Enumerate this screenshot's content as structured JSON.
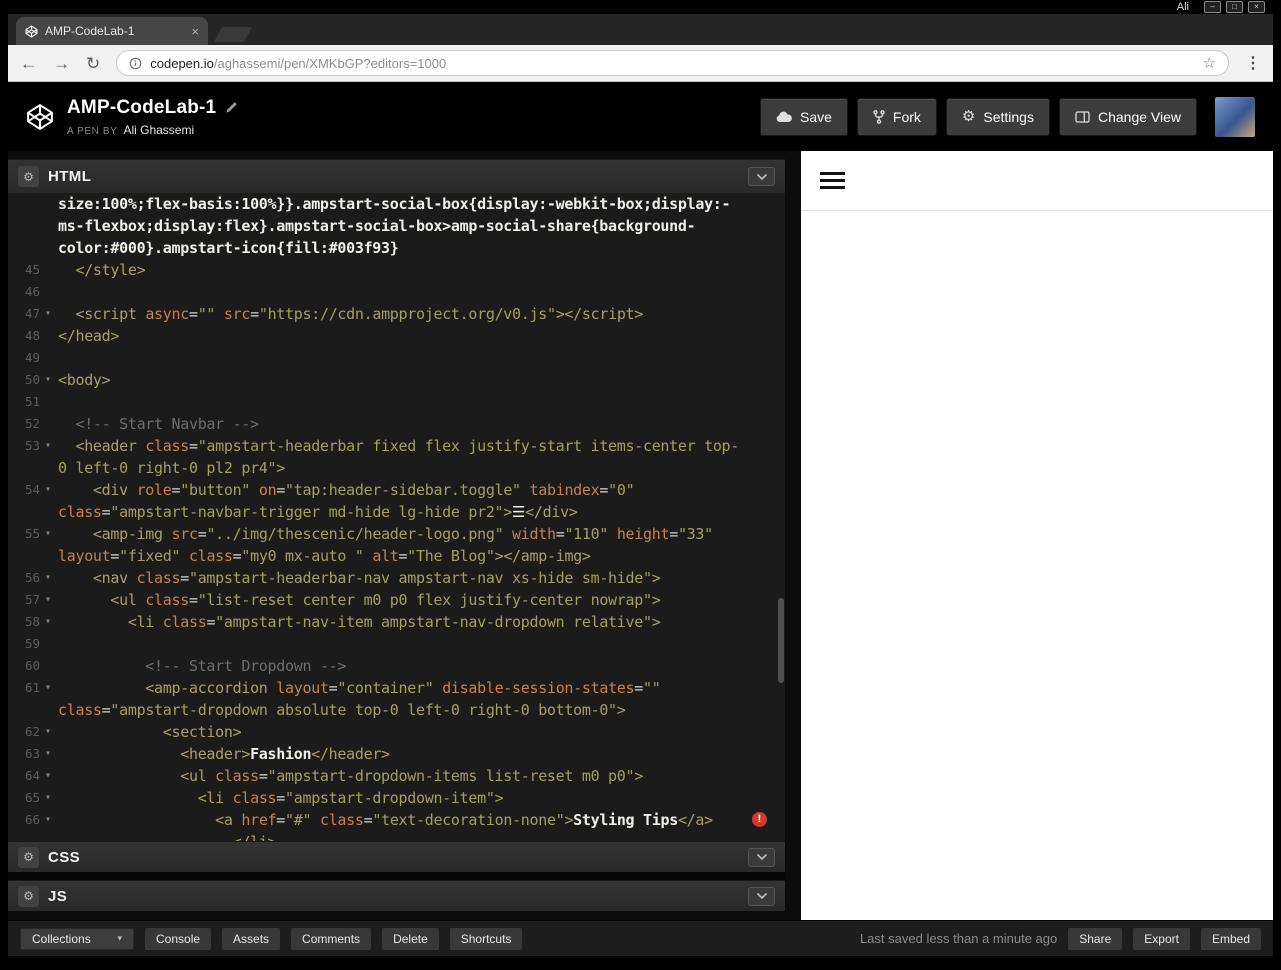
{
  "desktop": {
    "user_label": "Ali",
    "controls": [
      "–",
      "□",
      "×"
    ]
  },
  "browser": {
    "tab_title": "AMP-CodeLab-1",
    "url_host": "codepen.io",
    "url_path": "/aghassemi/pen/XMKbGP?editors=1000"
  },
  "header": {
    "pen_title": "AMP-CodeLab-1",
    "pen_by_label": "A PEN BY",
    "author": "Ali Ghassemi",
    "save_label": "Save",
    "fork_label": "Fork",
    "settings_label": "Settings",
    "change_view_label": "Change View"
  },
  "icons": {
    "back": "←",
    "forward": "→",
    "reload": "↻",
    "star": "☆",
    "menu_dots": "⋮",
    "close": "×",
    "gear": "⚙",
    "caret_down": "▾",
    "error": "!"
  },
  "editor": {
    "html_label": "HTML",
    "css_label": "CSS",
    "js_label": "JS",
    "syntax_colors": {
      "tag": "#ac9f6a",
      "attr": "#c9824d",
      "string": "#a4a05e",
      "text": "#f0efe9",
      "comment": "#6e6e6e",
      "punct": "#d8d6cf"
    },
    "rows": [
      {
        "tokens": [
          [
            "p",
            "size:100%;flex-basis:100%}}.ampstart-social-box{display:-webkit-box;display:-"
          ]
        ]
      },
      {
        "tokens": [
          [
            "p",
            "ms-flexbox;display:flex}.ampstart-social-box>amp-social-share{background-"
          ]
        ]
      },
      {
        "tokens": [
          [
            "p",
            "color:#000}.ampstart-icon{fill:#003f93}"
          ]
        ]
      },
      {
        "n": "45",
        "tokens": [
          [
            "t",
            "  </style>"
          ]
        ]
      },
      {
        "n": "46",
        "tokens": []
      },
      {
        "n": "47",
        "fold": true,
        "tokens": [
          [
            "t",
            "  <script "
          ],
          [
            "a",
            "async"
          ],
          [
            "w",
            "="
          ],
          [
            "s",
            "\"\""
          ],
          [
            "w",
            " "
          ],
          [
            "a",
            "src"
          ],
          [
            "w",
            "="
          ],
          [
            "s",
            "\"https://cdn.ampproject.org/v0.js\""
          ],
          [
            "t",
            "></script>"
          ]
        ]
      },
      {
        "n": "48",
        "tokens": [
          [
            "t",
            "</head>"
          ]
        ]
      },
      {
        "n": "49",
        "tokens": []
      },
      {
        "n": "50",
        "fold": true,
        "tokens": [
          [
            "t",
            "<body>"
          ]
        ]
      },
      {
        "n": "51",
        "tokens": []
      },
      {
        "n": "52",
        "tokens": [
          [
            "c",
            "  <!-- Start Navbar -->"
          ]
        ]
      },
      {
        "n": "53",
        "fold": true,
        "tokens": [
          [
            "t",
            "  <header "
          ],
          [
            "a",
            "class"
          ],
          [
            "w",
            "="
          ],
          [
            "s",
            "\"ampstart-headerbar fixed flex justify-start items-center top-"
          ]
        ]
      },
      {
        "tokens": [
          [
            "s",
            "0 left-0 right-0 pl2 pr4\""
          ],
          [
            "t",
            ">"
          ]
        ]
      },
      {
        "n": "54",
        "fold": true,
        "tokens": [
          [
            "t",
            "    <div "
          ],
          [
            "a",
            "role"
          ],
          [
            "w",
            "="
          ],
          [
            "s",
            "\"button\""
          ],
          [
            "w",
            " "
          ],
          [
            "a",
            "on"
          ],
          [
            "w",
            "="
          ],
          [
            "s",
            "\"tap:header-sidebar.toggle\""
          ],
          [
            "w",
            " "
          ],
          [
            "a",
            "tabindex"
          ],
          [
            "w",
            "="
          ],
          [
            "s",
            "\"0\""
          ]
        ]
      },
      {
        "tokens": [
          [
            "a",
            "class"
          ],
          [
            "w",
            "="
          ],
          [
            "s",
            "\"ampstart-navbar-trigger md-hide lg-hide pr2\""
          ],
          [
            "t",
            ">"
          ],
          [
            "p",
            "☰"
          ],
          [
            "t",
            "</div>"
          ]
        ]
      },
      {
        "n": "55",
        "fold": true,
        "tokens": [
          [
            "t",
            "    <amp-img "
          ],
          [
            "a",
            "src"
          ],
          [
            "w",
            "="
          ],
          [
            "s",
            "\"../img/thescenic/header-logo.png\""
          ],
          [
            "w",
            " "
          ],
          [
            "a",
            "width"
          ],
          [
            "w",
            "="
          ],
          [
            "s",
            "\"110\""
          ],
          [
            "w",
            " "
          ],
          [
            "a",
            "height"
          ],
          [
            "w",
            "="
          ],
          [
            "s",
            "\"33\""
          ]
        ]
      },
      {
        "tokens": [
          [
            "a",
            "layout"
          ],
          [
            "w",
            "="
          ],
          [
            "s",
            "\"fixed\""
          ],
          [
            "w",
            " "
          ],
          [
            "a",
            "class"
          ],
          [
            "w",
            "="
          ],
          [
            "s",
            "\"my0 mx-auto \""
          ],
          [
            "w",
            " "
          ],
          [
            "a",
            "alt"
          ],
          [
            "w",
            "="
          ],
          [
            "s",
            "\"The Blog\""
          ],
          [
            "t",
            "></amp-img>"
          ]
        ]
      },
      {
        "n": "56",
        "fold": true,
        "tokens": [
          [
            "t",
            "    <nav "
          ],
          [
            "a",
            "class"
          ],
          [
            "w",
            "="
          ],
          [
            "s",
            "\"ampstart-headerbar-nav ampstart-nav xs-hide sm-hide\""
          ],
          [
            "t",
            ">"
          ]
        ]
      },
      {
        "n": "57",
        "fold": true,
        "tokens": [
          [
            "t",
            "      <ul "
          ],
          [
            "a",
            "class"
          ],
          [
            "w",
            "="
          ],
          [
            "s",
            "\"list-reset center m0 p0 flex justify-center nowrap\""
          ],
          [
            "t",
            ">"
          ]
        ]
      },
      {
        "n": "58",
        "fold": true,
        "tokens": [
          [
            "t",
            "        <li "
          ],
          [
            "a",
            "class"
          ],
          [
            "w",
            "="
          ],
          [
            "s",
            "\"ampstart-nav-item ampstart-nav-dropdown relative\""
          ],
          [
            "t",
            ">"
          ]
        ]
      },
      {
        "n": "59",
        "tokens": []
      },
      {
        "n": "60",
        "tokens": [
          [
            "c",
            "          <!-- Start Dropdown -->"
          ]
        ]
      },
      {
        "n": "61",
        "fold": true,
        "tokens": [
          [
            "t",
            "          <amp-accordion "
          ],
          [
            "a",
            "layout"
          ],
          [
            "w",
            "="
          ],
          [
            "s",
            "\"container\""
          ],
          [
            "w",
            " "
          ],
          [
            "a",
            "disable-session-states"
          ],
          [
            "w",
            "="
          ],
          [
            "s",
            "\"\""
          ]
        ]
      },
      {
        "tokens": [
          [
            "a",
            "class"
          ],
          [
            "w",
            "="
          ],
          [
            "s",
            "\"ampstart-dropdown absolute top-0 left-0 right-0 bottom-0\""
          ],
          [
            "t",
            ">"
          ]
        ]
      },
      {
        "n": "62",
        "fold": true,
        "tokens": [
          [
            "t",
            "            <section>"
          ]
        ]
      },
      {
        "n": "63",
        "fold": true,
        "tokens": [
          [
            "t",
            "              <header>"
          ],
          [
            "p",
            "Fashion"
          ],
          [
            "t",
            "</header>"
          ]
        ]
      },
      {
        "n": "64",
        "fold": true,
        "tokens": [
          [
            "t",
            "              <ul "
          ],
          [
            "a",
            "class"
          ],
          [
            "w",
            "="
          ],
          [
            "s",
            "\"ampstart-dropdown-items list-reset m0 p0\""
          ],
          [
            "t",
            ">"
          ]
        ]
      },
      {
        "n": "65",
        "fold": true,
        "tokens": [
          [
            "t",
            "                <li "
          ],
          [
            "a",
            "class"
          ],
          [
            "w",
            "="
          ],
          [
            "s",
            "\"ampstart-dropdown-item\""
          ],
          [
            "t",
            ">"
          ]
        ]
      },
      {
        "n": "66",
        "fold": true,
        "err": true,
        "tokens": [
          [
            "t",
            "                  <a "
          ],
          [
            "a",
            "href"
          ],
          [
            "w",
            "="
          ],
          [
            "s",
            "\"#\""
          ],
          [
            "w",
            " "
          ],
          [
            "a",
            "class"
          ],
          [
            "w",
            "="
          ],
          [
            "s",
            "\"text-decoration-none\""
          ],
          [
            "t",
            ">"
          ],
          [
            "p",
            "Styling Tips"
          ],
          [
            "t",
            "</a>"
          ]
        ]
      },
      {
        "tokens": [
          [
            "t",
            "                    </li>"
          ]
        ]
      }
    ]
  },
  "footer": {
    "collections_label": "Collections",
    "console_label": "Console",
    "assets_label": "Assets",
    "comments_label": "Comments",
    "delete_label": "Delete",
    "shortcuts_label": "Shortcuts",
    "saved_status": "Last saved less than a minute ago",
    "share_label": "Share",
    "export_label": "Export",
    "embed_label": "Embed"
  }
}
